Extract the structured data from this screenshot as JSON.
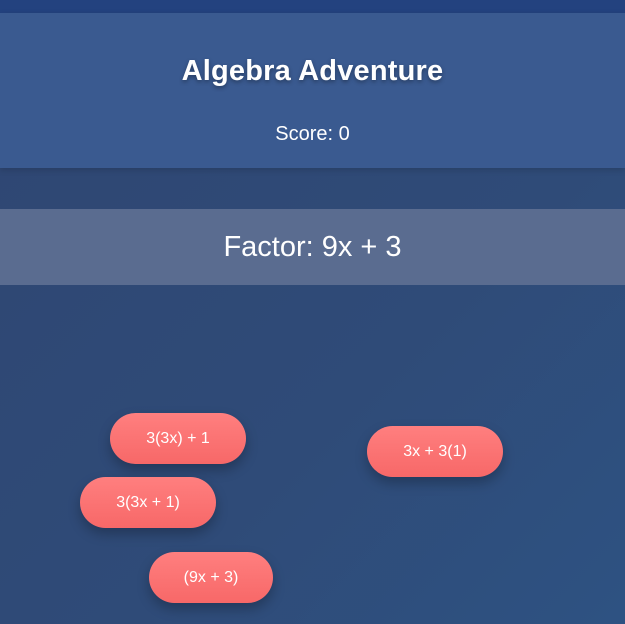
{
  "header": {
    "title": "Algebra Adventure",
    "score_label": "Score: 0"
  },
  "problem": {
    "text": "Factor: 9x + 3"
  },
  "answers": [
    {
      "label": "3(3x) + 1"
    },
    {
      "label": "3x + 3(1)"
    },
    {
      "label": "3(3x + 1)"
    },
    {
      "label": "(9x + 3)"
    }
  ],
  "colors": {
    "header_bg": "#3a5a90",
    "top_strip": "#23427f",
    "problem_bar_bg": "#5a6c90",
    "page_bg": "#2f4672",
    "answer_pill": "#ff7676",
    "text": "#ffffff"
  }
}
